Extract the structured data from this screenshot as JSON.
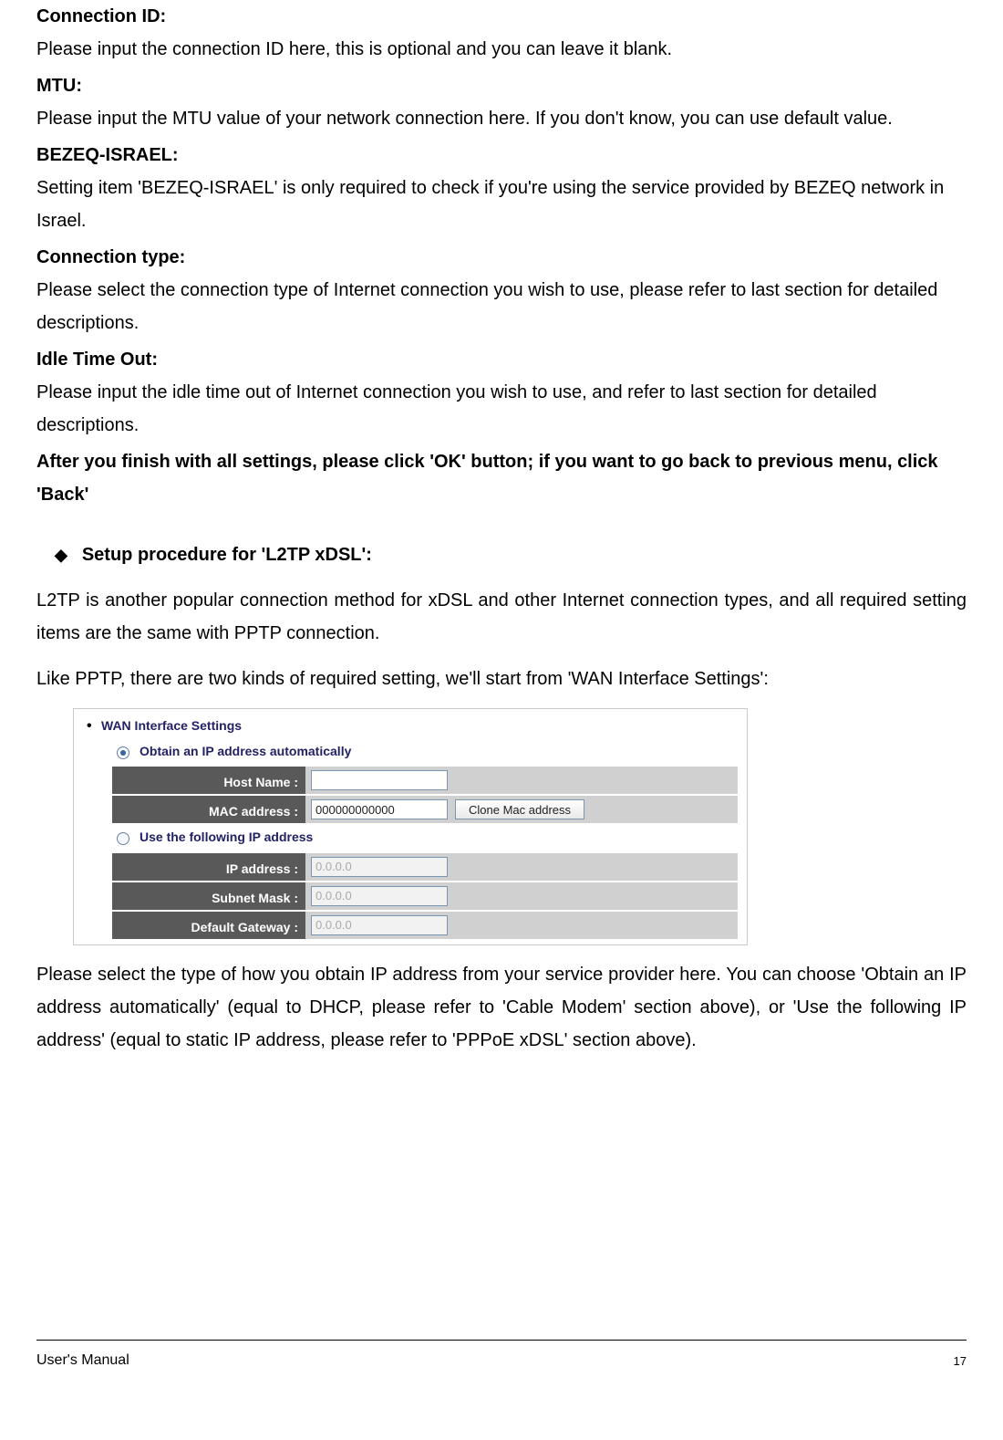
{
  "defs": [
    {
      "term": "Connection ID:",
      "desc": "Please input the connection ID here, this is optional and you can leave it blank."
    },
    {
      "term": "MTU:",
      "desc": "Please input the MTU value of your network connection here. If you don't know, you can use default value."
    },
    {
      "term": "BEZEQ-ISRAEL:",
      "desc": "Setting item 'BEZEQ-ISRAEL' is only required to check if you're using the service provided by BEZEQ network in Israel."
    },
    {
      "term": "Connection type:",
      "desc": "Please select the connection type of Internet connection you wish to use, please refer to last section for detailed descriptions."
    },
    {
      "term": "Idle Time Out:",
      "desc": "Please input the idle time out of Internet connection you wish to use, and refer to last section for detailed descriptions."
    }
  ],
  "closing": "After you finish with all settings, please click 'OK' button; if you want to go back to previous menu, click 'Back'",
  "bullet_heading": "Setup procedure for 'L2TP xDSL':",
  "para1": "L2TP is another popular connection method for xDSL and other Internet connection types, and all required setting items are the same with PPTP connection.",
  "para2": "Like PPTP, there are two kinds of required setting, we'll start from 'WAN Interface Settings':",
  "para3": "Please select the type of how you obtain IP address from your service provider here. You can choose 'Obtain an IP address automatically' (equal to DHCP, please refer to 'Cable Modem' section above), or 'Use the following IP address' (equal to static IP address, please refer to 'PPPoE xDSL' section above).",
  "screenshot": {
    "title": "WAN Interface Settings",
    "radio_auto": "Obtain an IP address automatically",
    "radio_static": "Use the following IP address",
    "host_label": "Host Name :",
    "host_value": "",
    "mac_label": "MAC address :",
    "mac_value": "000000000000",
    "clone_btn": "Clone Mac address",
    "ip_label": "IP address :",
    "ip_value": "0.0.0.0",
    "mask_label": "Subnet Mask :",
    "mask_value": "0.0.0.0",
    "gw_label": "Default Gateway :",
    "gw_value": "0.0.0.0"
  },
  "footer": {
    "title": "User's Manual",
    "page": "17"
  }
}
